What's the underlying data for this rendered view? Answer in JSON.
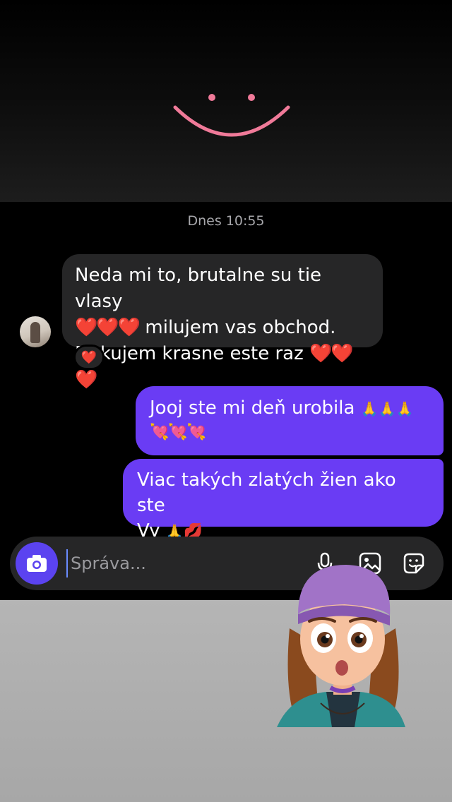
{
  "chat": {
    "timestamp": "Dnes 10:55",
    "incoming": {
      "line1": "Neda mi to, brutalne su tie vlasy",
      "line2_hearts": "❤️❤️❤️",
      "line2_text": " milujem vas obchod.",
      "line3_text": "Dakujem krasne este raz ",
      "line3_hearts": "❤️❤️❤️",
      "reaction": "❤️"
    },
    "outgoing": [
      {
        "text": "Jooj ste mi deň urobila ",
        "emoji_pray": "🙏🙏🙏",
        "emoji_hearts": "💘💘💘"
      },
      {
        "text_line1": "Viac takých zlatých žien ako ste",
        "text_line2": "Vy ",
        "emoji_pray": "🙏",
        "emoji_kiss": "💋"
      }
    ]
  },
  "composer": {
    "placeholder": "Správa...",
    "icons": [
      "camera-icon",
      "microphone-icon",
      "gallery-icon",
      "sticker-icon"
    ]
  },
  "colors": {
    "outgoing_bubble": "#6a3cf4",
    "incoming_bubble": "#262627",
    "camera_button": "#5b43f0",
    "smiley": "#f07a99"
  }
}
